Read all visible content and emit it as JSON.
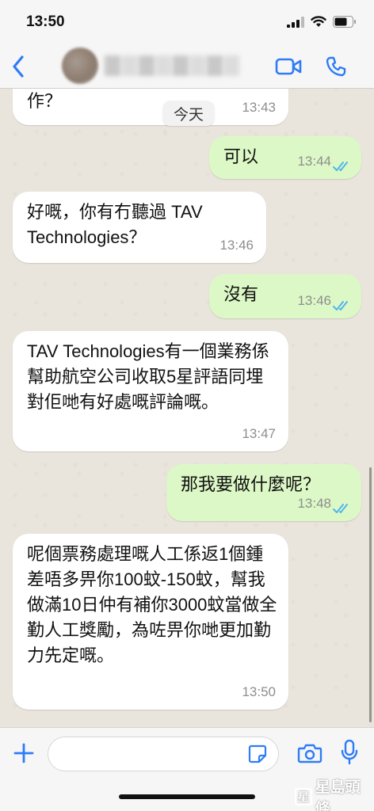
{
  "status_bar": {
    "time": "13:50"
  },
  "header": {
    "back_label": "<"
  },
  "chat": {
    "partial_top_text": "作？",
    "date_label": "今天",
    "messages": [
      {
        "direction": "in",
        "text": "作？",
        "time": "13:43"
      },
      {
        "direction": "out",
        "text": "可以",
        "time": "13:44",
        "read": true
      },
      {
        "direction": "in",
        "text": "好嘅，你有冇聽過 TAV Technologies？",
        "time": "13:46"
      },
      {
        "direction": "out",
        "text": "沒有",
        "time": "13:46",
        "read": true
      },
      {
        "direction": "in",
        "text": "TAV Technologies有一個業務係幫助航空公司收取5星評語同埋對佢哋有好處嘅評論嘅。",
        "time": "13:47"
      },
      {
        "direction": "out",
        "text": "那我要做什麼呢？",
        "time": "13:48",
        "read": true
      },
      {
        "direction": "in",
        "text": "呢個票務處理嘅人工係返1個鍾差唔多畀你100蚊-150蚊，幫我做滿10日仲有補你3000蚊當做全勤人工獎勵，為咗畀你哋更加勤力先定嘅。",
        "time": "13:50"
      }
    ]
  },
  "input": {
    "value": "",
    "placeholder": ""
  },
  "watermark": {
    "text": "星島頭條",
    "badge": "星"
  },
  "colors": {
    "accent": "#2e7cf6",
    "outgoing_bubble": "#dcf8c6",
    "incoming_bubble": "#ffffff",
    "read_ticks": "#4fb6ec"
  }
}
